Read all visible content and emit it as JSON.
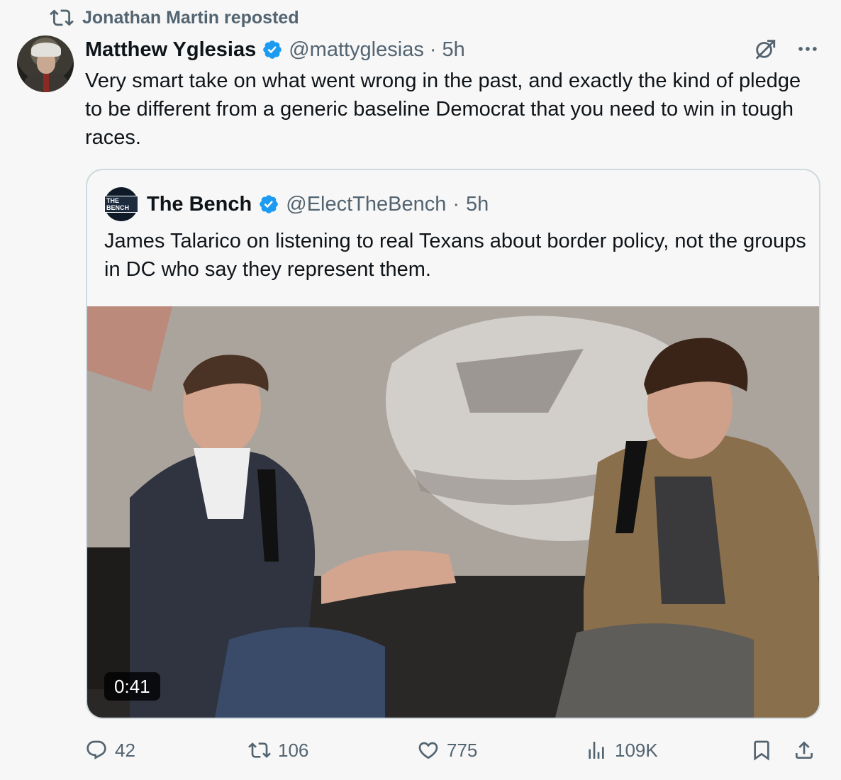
{
  "repost": {
    "label": "Jonathan Martin reposted"
  },
  "tweet": {
    "author_name": "Matthew Yglesias",
    "handle": "@mattyglesias",
    "separator": "·",
    "time": "5h",
    "text": "Very smart take on what went wrong in the past, and exactly the kind of pledge to be different from a generic baseline Democrat that you need to win in tough races."
  },
  "quote": {
    "author_name": "The Bench",
    "avatar_text": "THE BENCH",
    "handle": "@ElectTheBench",
    "separator": "·",
    "time": "5h",
    "text": "James Talarico on listening to real Texans about border policy, not the groups in DC who say they represent them.",
    "video_duration": "0:41"
  },
  "actions": {
    "replies": "42",
    "reposts": "106",
    "likes": "775",
    "views": "109K"
  },
  "colors": {
    "verified": "#1d9bf0",
    "muted": "#536471",
    "text": "#0f1419",
    "border": "#cfd9de"
  },
  "icons": [
    "repost-icon",
    "verified-badge-icon",
    "grok-icon",
    "more-icon",
    "reply-icon",
    "retweet-icon",
    "like-icon",
    "views-icon",
    "bookmark-icon",
    "share-icon"
  ]
}
